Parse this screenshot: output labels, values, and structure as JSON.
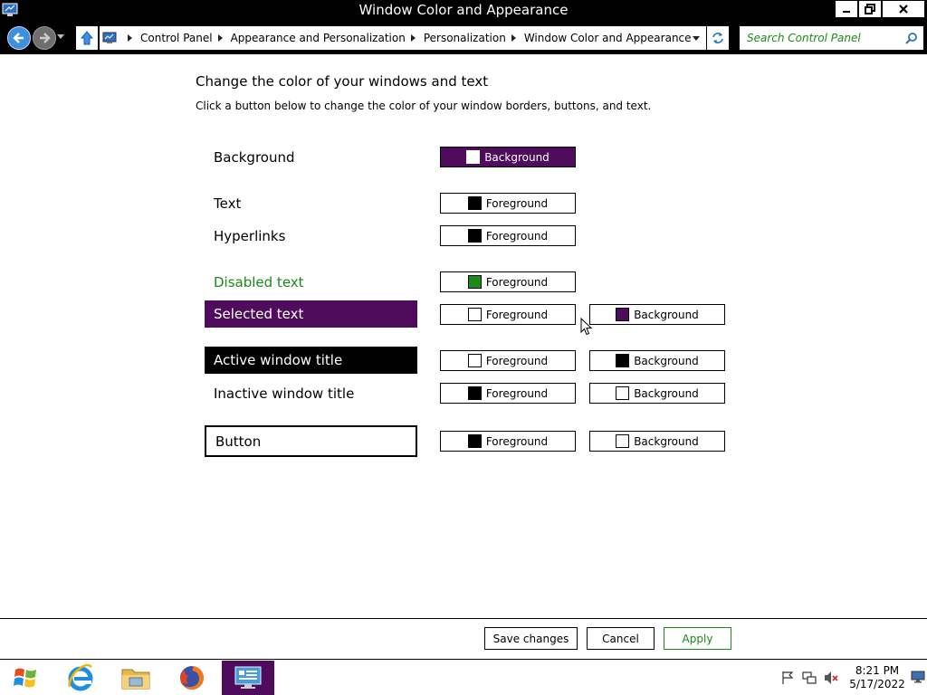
{
  "window": {
    "title": "Window Color and Appearance",
    "controls": {
      "minimize": "minimize",
      "maximize": "restore",
      "close": "close"
    }
  },
  "address": {
    "breadcrumbs": [
      "Control Panel",
      "Appearance and Personalization",
      "Personalization",
      "Window Color and Appearance"
    ],
    "search_placeholder": "Search Control Panel"
  },
  "content": {
    "heading": "Change the color of your windows and text",
    "subheading": "Click a button below to change the color of your window borders, buttons, and text.",
    "rows": [
      {
        "label": "Background",
        "buttons": [
          {
            "label": "Background",
            "swatch": "#ffffff",
            "selected": true
          }
        ]
      },
      {
        "label": "Text",
        "buttons": [
          {
            "label": "Foreground",
            "swatch": "#000000"
          }
        ]
      },
      {
        "label": "Hyperlinks",
        "buttons": [
          {
            "label": "Foreground",
            "swatch": "#000000"
          }
        ]
      },
      {
        "label": "Disabled text",
        "buttons": [
          {
            "label": "Foreground",
            "swatch": "#1a8a1a"
          }
        ]
      },
      {
        "label": "Selected text",
        "buttons": [
          {
            "label": "Foreground",
            "swatch": "#ffffff"
          },
          {
            "label": "Background",
            "swatch": "#4f0b5c"
          }
        ]
      },
      {
        "label": "Active window title",
        "buttons": [
          {
            "label": "Foreground",
            "swatch": "#ffffff"
          },
          {
            "label": "Background",
            "swatch": "#000000"
          }
        ]
      },
      {
        "label": "Inactive window title",
        "buttons": [
          {
            "label": "Foreground",
            "swatch": "#000000"
          },
          {
            "label": "Background",
            "swatch": "#ffffff"
          }
        ]
      },
      {
        "label": "Button",
        "buttons": [
          {
            "label": "Foreground",
            "swatch": "#000000"
          },
          {
            "label": "Background",
            "swatch": "#ffffff"
          }
        ]
      }
    ]
  },
  "actions": {
    "save": "Save changes",
    "cancel": "Cancel",
    "apply": "Apply"
  },
  "taskbar": {
    "items": [
      "start-icon",
      "internet-explorer-icon",
      "file-explorer-icon",
      "firefox-icon",
      "control-panel-icon"
    ],
    "time": "8:21 PM",
    "date": "5/17/2022"
  },
  "colors": {
    "accent": "#4f0b5c",
    "disabled": "#1a8a1a",
    "highlight_text": "#ffffff",
    "titlebar": "#000000"
  }
}
